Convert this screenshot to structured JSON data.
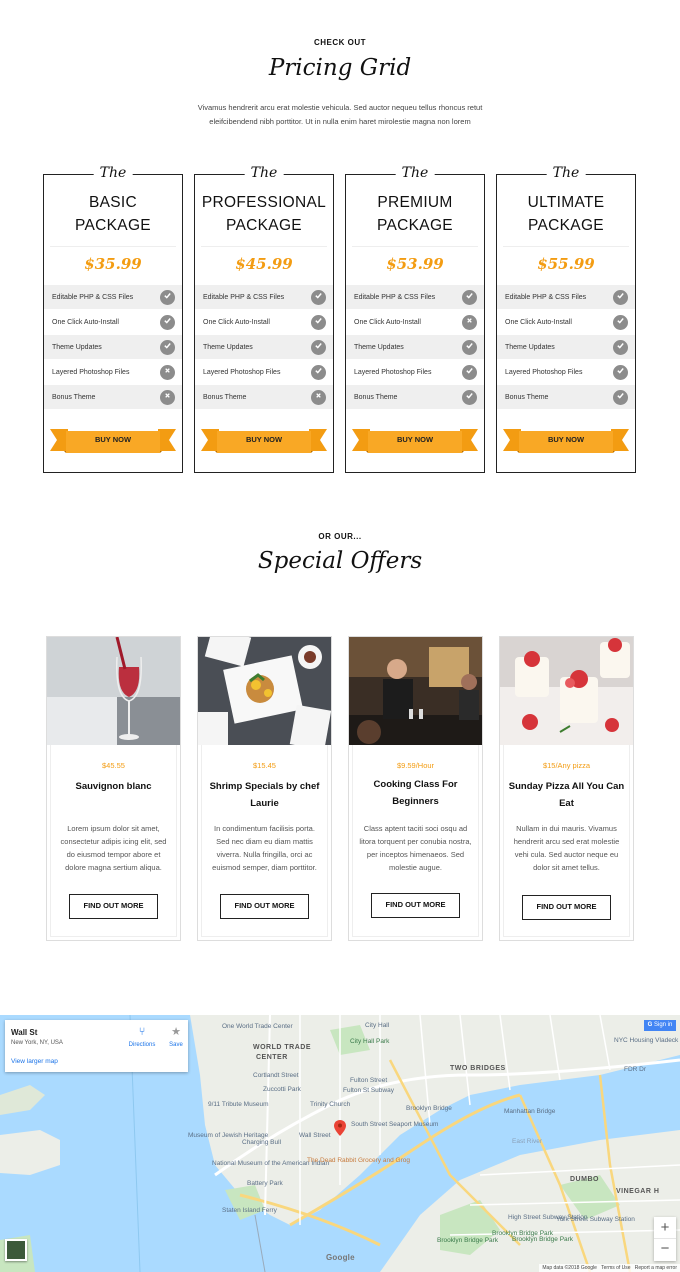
{
  "pricing": {
    "eyebrow": "CHECK OUT",
    "title": "Pricing Grid",
    "intro": "Vivamus hendrerit arcu erat molestie vehicula. Sed auctor nequeu tellus rhoncus retut eleifcibendend nibh porttitor. Ut in nulla enim haret mirolestie magna non lorem",
    "the_label": "The",
    "buy_label": "BUY NOW",
    "accent": "#f39c12",
    "packages": [
      {
        "line1": "BASIC",
        "line2": "PACKAGE",
        "price": "$35.99",
        "features": [
          {
            "label": "Editable PHP & CSS Files",
            "icon": "check-icon"
          },
          {
            "label": "One Click Auto-Install",
            "icon": "check-icon"
          },
          {
            "label": "Theme Updates",
            "icon": "check-icon"
          },
          {
            "label": "Layered Photoshop Files",
            "icon": "cross-icon"
          },
          {
            "label": "Bonus Theme",
            "icon": "cross-icon"
          }
        ]
      },
      {
        "line1": "PROFESSIONAL",
        "line2": "PACKAGE",
        "price": "$45.99",
        "features": [
          {
            "label": "Editable PHP & CSS Files",
            "icon": "check-icon"
          },
          {
            "label": "One Click Auto-Install",
            "icon": "check-icon"
          },
          {
            "label": "Theme Updates",
            "icon": "check-icon"
          },
          {
            "label": "Layered Photoshop Files",
            "icon": "check-icon"
          },
          {
            "label": "Bonus Theme",
            "icon": "cross-icon"
          }
        ]
      },
      {
        "line1": "PREMIUM",
        "line2": "PACKAGE",
        "price": "$53.99",
        "features": [
          {
            "label": "Editable PHP & CSS Files",
            "icon": "check-icon"
          },
          {
            "label": "One Click Auto-Install",
            "icon": "cross-icon"
          },
          {
            "label": "Theme Updates",
            "icon": "check-icon"
          },
          {
            "label": "Layered Photoshop Files",
            "icon": "check-icon"
          },
          {
            "label": "Bonus Theme",
            "icon": "check-icon"
          }
        ]
      },
      {
        "line1": "ULTIMATE",
        "line2": "PACKAGE",
        "price": "$55.99",
        "features": [
          {
            "label": "Editable PHP & CSS Files",
            "icon": "check-icon"
          },
          {
            "label": "One Click Auto-Install",
            "icon": "check-icon"
          },
          {
            "label": "Theme Updates",
            "icon": "check-icon"
          },
          {
            "label": "Layered Photoshop Files",
            "icon": "check-icon"
          },
          {
            "label": "Bonus Theme",
            "icon": "check-icon"
          }
        ]
      }
    ]
  },
  "offers": {
    "eyebrow": "OR OUR...",
    "title": "Special Offers",
    "button_label": "FIND OUT MORE",
    "items": [
      {
        "price": "$45.55",
        "name": "Sauvignon blanc",
        "image": "red-wine-glass-photo",
        "desc": "Lorem ipsum dolor sit amet, consectetur adipis icing elit, sed do eiusmod tempor abore et dolore magna sertium aliqua."
      },
      {
        "price": "$15.45",
        "name": "Shrimp Specials by chef Laurie",
        "image": "plated-food-photo",
        "desc": "In condimentum facilisis porta. Sed nec diam eu diam mattis viverra. Nulla fringilla, orci ac euismod semper, diam porttitor."
      },
      {
        "price": "$9.59/Hour",
        "name": "Cooking Class For Beginners",
        "image": "chef-bar-photo",
        "desc": "Class aptent taciti soci osqu ad litora torquent per conubia nostra, per inceptos himenaeos. Sed molestie augue."
      },
      {
        "price": "$15/Any pizza",
        "name": "Sunday Pizza All You Can Eat",
        "image": "strawberry-dessert-photo",
        "desc": "Nullam in dui mauris. Vivamus hendrerit arcu sed erat molestie vehi cula. Sed auctor neque eu dolor sit amet tellus."
      }
    ]
  },
  "map": {
    "place": "Wall St",
    "address": "New York, NY, USA",
    "view_larger": "View larger map",
    "directions": "Directions",
    "save": "Save",
    "sign_in": "Sign in",
    "zoom_in": "+",
    "zoom_out": "−",
    "google": "Google",
    "footer": [
      "Map data ©2018 Google",
      "Terms of Use",
      "Report a map error"
    ],
    "labels": [
      "One World Trade Center",
      "WORLD TRADE",
      "CENTER",
      "City Hall",
      "City Hall Park",
      "Cortlandt Street",
      "Fulton Street",
      "Fulton St Subway",
      "Zuccotti Park",
      "9/11 Tribute Museum",
      "Trinity Church",
      "Wall Street",
      "South Street Seaport Museum",
      "Museum of Jewish Heritage",
      "Charging Bull",
      "National Museum of the American Indian",
      "The Dead Rabbit Grocery and Grog",
      "Battery Park",
      "Staten Island Ferry",
      "TWO BRIDGES",
      "Brooklyn Bridge",
      "Manhattan Bridge",
      "East River",
      "DUMBO",
      "VINEGAR H",
      "FDR Dr",
      "NYC Housing Vladeck Houses",
      "Brooklyn Bridge Park",
      "High Street Subway Station",
      "York Street Subway Station",
      "Brooklyn Bridge Park",
      "Brooklyn Bridge Park"
    ]
  }
}
